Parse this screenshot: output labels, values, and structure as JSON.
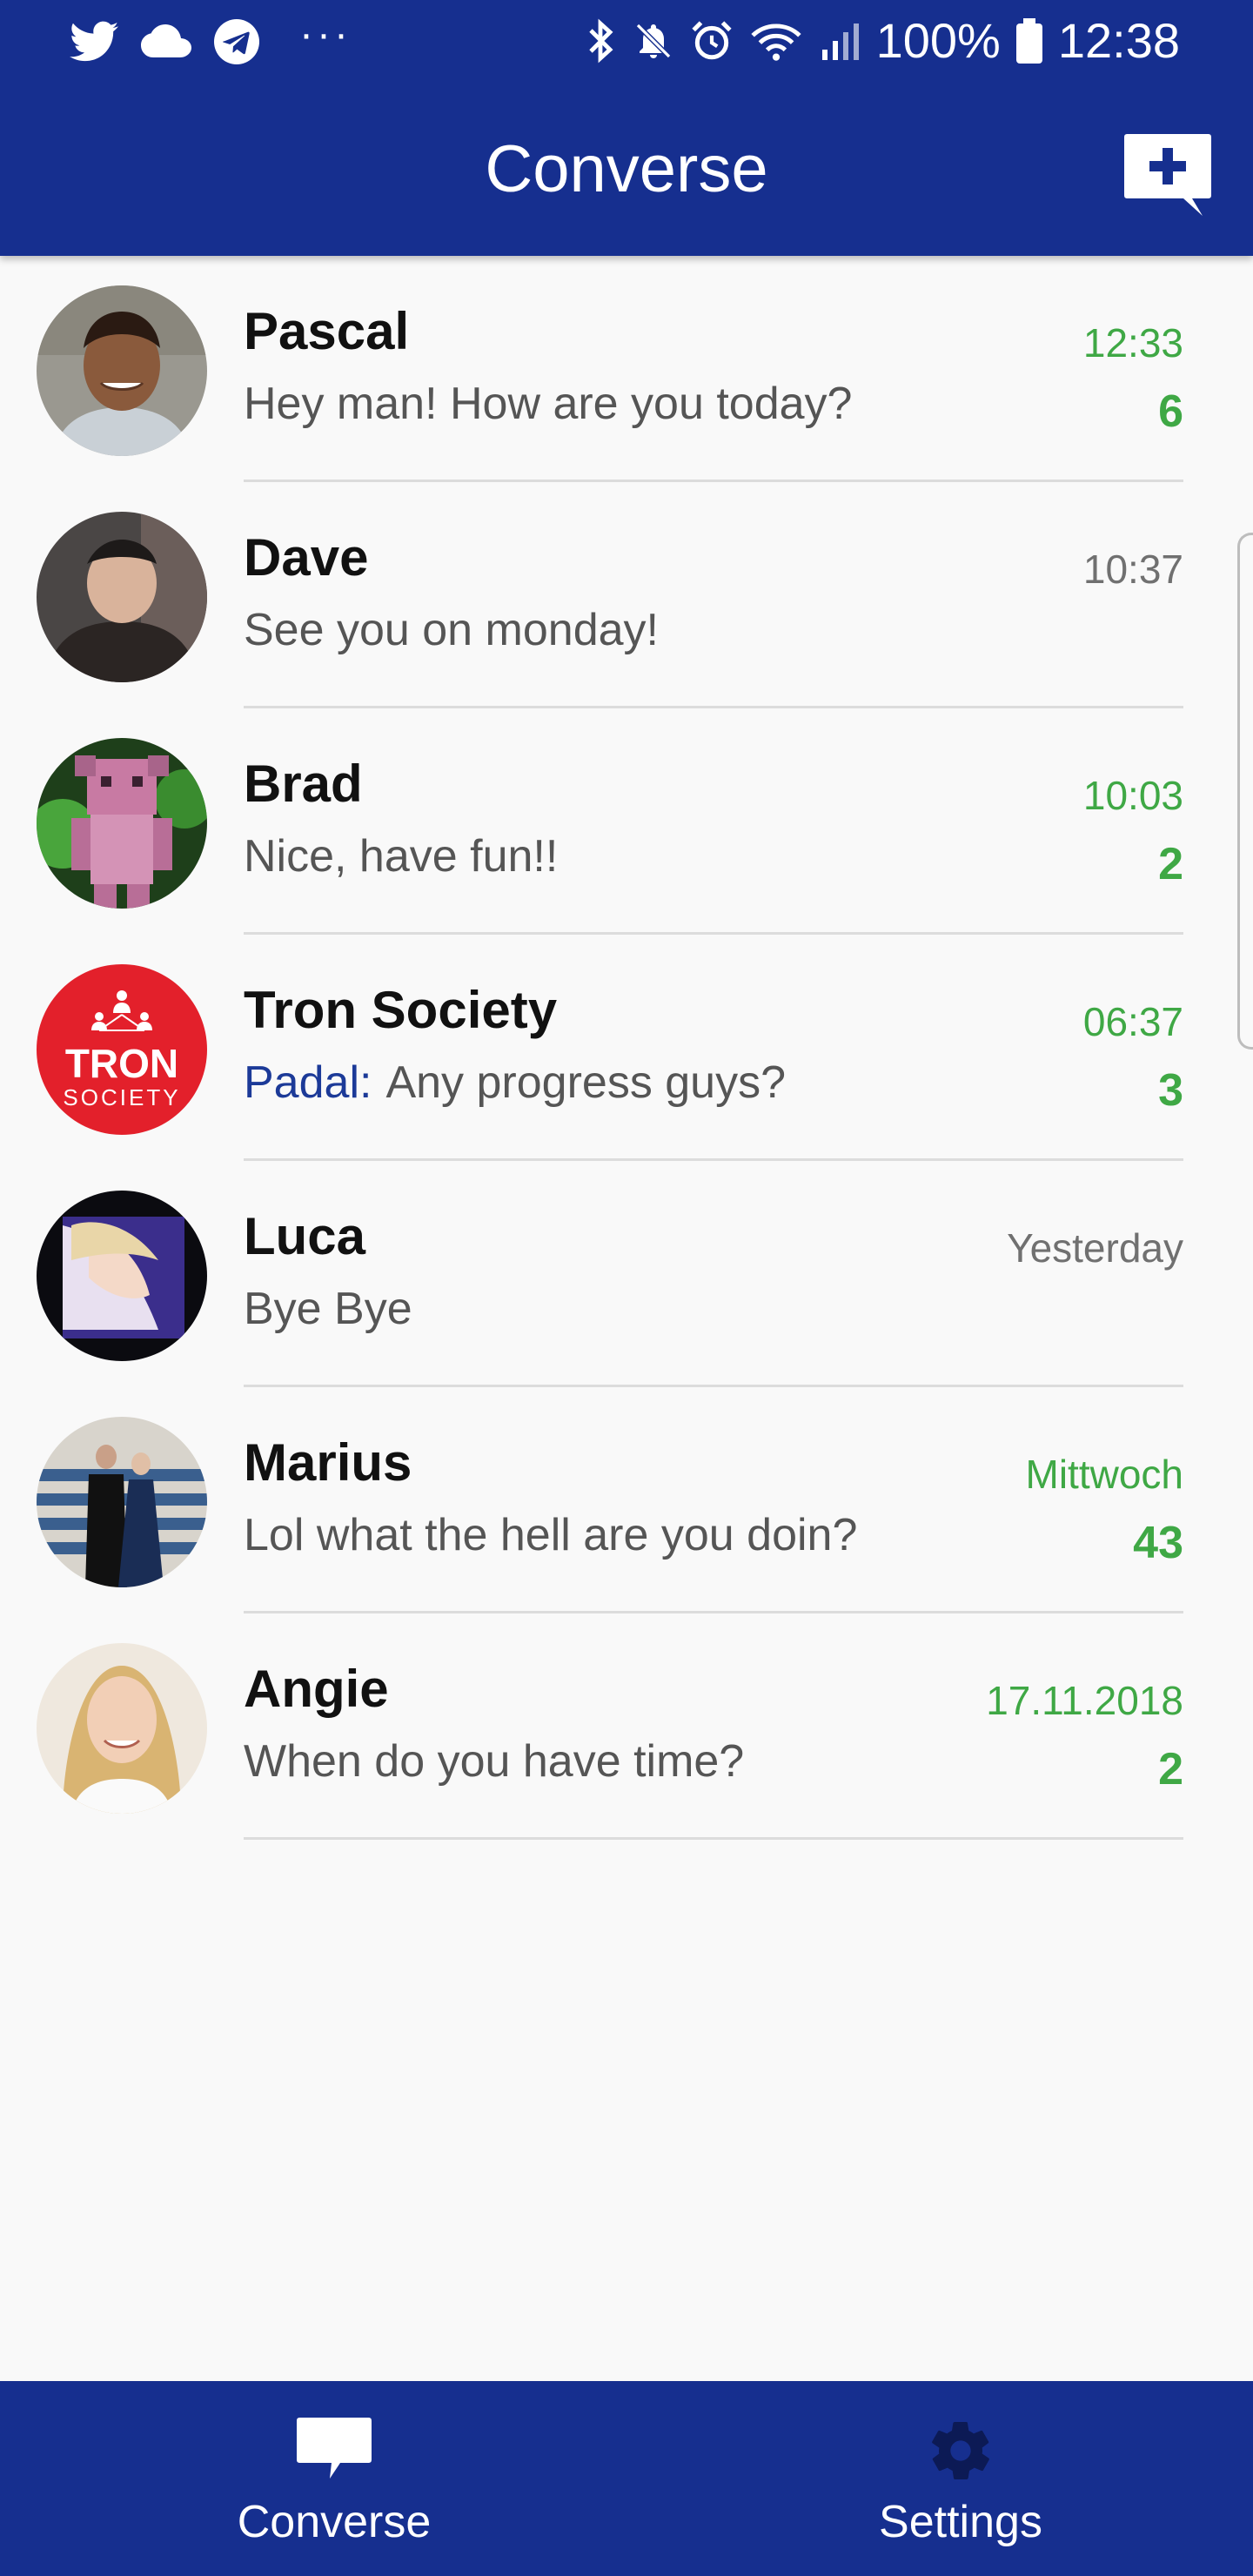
{
  "status_bar": {
    "battery": "100%",
    "time": "12:38",
    "more": "···"
  },
  "header": {
    "title": "Converse"
  },
  "colors": {
    "primary": "#162f8f",
    "unread": "#3fa845",
    "sender": "#1c3a98"
  },
  "chats": [
    {
      "name": "Pascal",
      "sender": "",
      "preview": "Hey man! How are you today?",
      "time": "12:33",
      "unread": "6"
    },
    {
      "name": "Dave",
      "sender": "",
      "preview": "See you on monday!",
      "time": "10:37",
      "unread": ""
    },
    {
      "name": "Brad",
      "sender": "",
      "preview": "Nice, have fun!!",
      "time": "10:03",
      "unread": "2"
    },
    {
      "name": "Tron Society",
      "sender": "Padal:",
      "preview": "Any progress guys?",
      "time": "06:37",
      "unread": "3"
    },
    {
      "name": "Luca",
      "sender": "",
      "preview": "Bye Bye",
      "time": "Yesterday",
      "unread": ""
    },
    {
      "name": "Marius",
      "sender": "",
      "preview": "Lol what the hell are you doin?",
      "time": "Mittwoch",
      "unread": "43"
    },
    {
      "name": "Angie",
      "sender": "",
      "preview": "When do you have time?",
      "time": "17.11.2018",
      "unread": "2"
    }
  ],
  "tron_logo": {
    "line1": "TRON",
    "line2": "SOCIETY"
  },
  "nav": {
    "converse": "Converse",
    "settings": "Settings"
  }
}
